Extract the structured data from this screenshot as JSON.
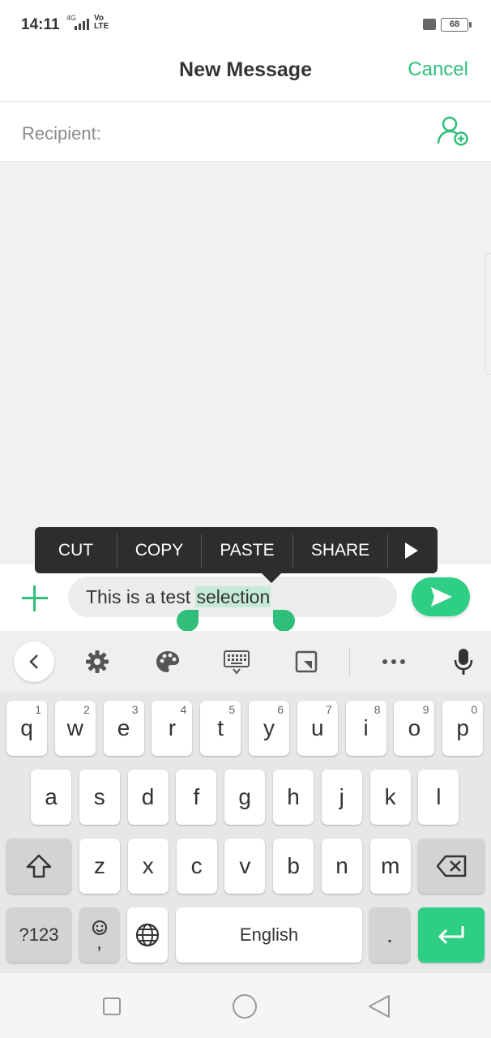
{
  "status_bar": {
    "time": "14:11",
    "network": "4G",
    "volte": "Vo\nLTE",
    "battery": "68"
  },
  "header": {
    "title": "New Message",
    "cancel_label": "Cancel"
  },
  "recipient": {
    "label": "Recipient:"
  },
  "context_menu": {
    "items": [
      "CUT",
      "COPY",
      "PASTE",
      "SHARE"
    ]
  },
  "compose": {
    "text_before": "This is a test ",
    "text_selected": "selection"
  },
  "keyboard": {
    "row1": [
      {
        "key": "q",
        "hint": "1"
      },
      {
        "key": "w",
        "hint": "2"
      },
      {
        "key": "e",
        "hint": "3"
      },
      {
        "key": "r",
        "hint": "4"
      },
      {
        "key": "t",
        "hint": "5"
      },
      {
        "key": "y",
        "hint": "6"
      },
      {
        "key": "u",
        "hint": "7"
      },
      {
        "key": "i",
        "hint": "8"
      },
      {
        "key": "o",
        "hint": "9"
      },
      {
        "key": "p",
        "hint": "0"
      }
    ],
    "row2": [
      "a",
      "s",
      "d",
      "f",
      "g",
      "h",
      "j",
      "k",
      "l"
    ],
    "row3": [
      "z",
      "x",
      "c",
      "v",
      "b",
      "n",
      "m"
    ],
    "symbols_label": "?123",
    "emoji_comma": ",",
    "space_label": "English",
    "period": "."
  },
  "colors": {
    "accent": "#2fbf7a",
    "send": "#2fce85",
    "menu_bg": "#2d2d2d",
    "selection": "#c5ead7"
  }
}
